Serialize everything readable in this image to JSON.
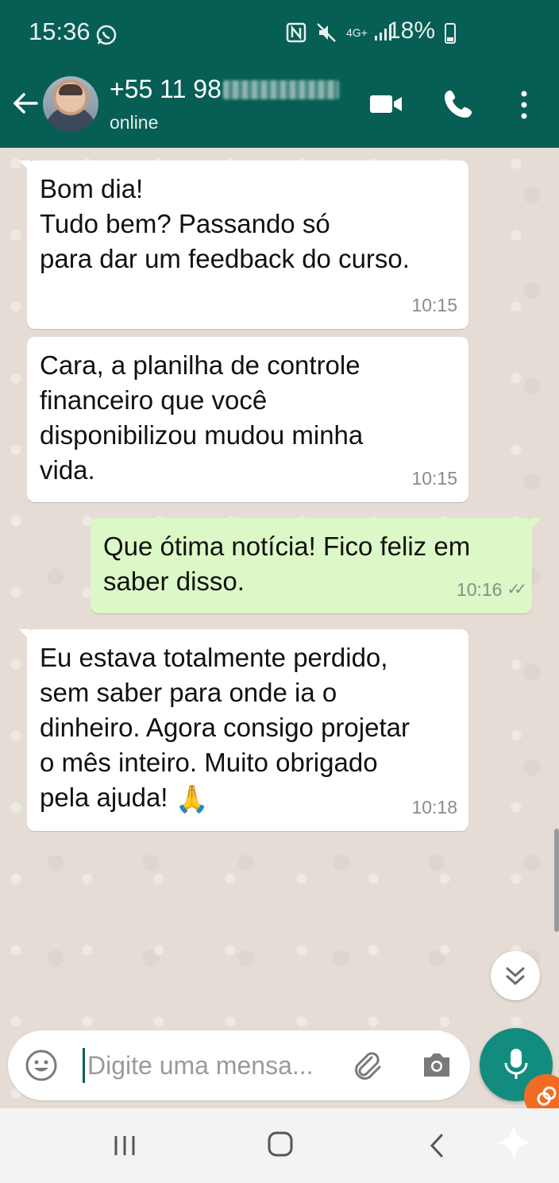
{
  "status_bar": {
    "time": "15:36",
    "network": "4G+",
    "battery": "18%"
  },
  "app_bar": {
    "contact_number_visible": "+55 11 98",
    "contact_status": "online"
  },
  "messages": [
    {
      "direction": "incoming",
      "text": "Bom dia!\nTudo bem? Passando só\npara dar um feedback do curso.",
      "time": "10:15"
    },
    {
      "direction": "incoming",
      "text": "Cara, a planilha de controle\nfinanceiro que você\ndisponibilizou mudou minha\nvida.",
      "time": "10:15"
    },
    {
      "direction": "outgoing",
      "text": "Que ótima notícia! Fico feliz em\nsaber disso.",
      "time": "10:16",
      "ticks": "✓✓"
    },
    {
      "direction": "incoming",
      "text": "Eu estava totalmente perdido,\nsem saber para onde ia o\ndinheiro. Agora consigo projetar\no mês inteiro. Muito obrigado\npela ajuda! ",
      "emoji": "🙏",
      "time": "10:18"
    }
  ],
  "composer": {
    "placeholder": "Digite uma mensa..."
  },
  "colors": {
    "header": "#075e54",
    "chat_bg": "#e5ddd5",
    "outgoing_bubble": "#dcf8c6",
    "mic_button": "#128c7e"
  },
  "icons": [
    "whatsapp-icon",
    "nfc-icon",
    "mute-icon",
    "signal-icon",
    "battery-icon",
    "back-arrow-icon",
    "video-call-icon",
    "voice-call-icon",
    "more-vert-icon",
    "double-check-icon",
    "chevron-double-down-icon",
    "emoji-icon",
    "attach-icon",
    "camera-icon",
    "mic-icon",
    "recent-apps-icon",
    "home-icon",
    "nav-back-icon",
    "sparkle-icon"
  ]
}
